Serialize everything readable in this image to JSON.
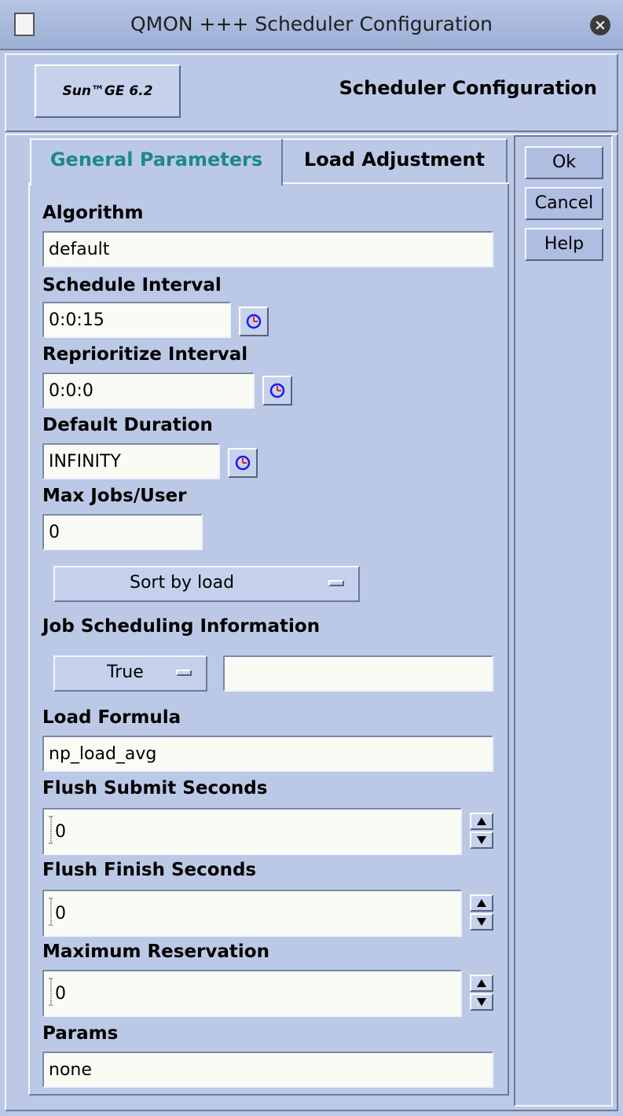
{
  "window": {
    "title": "QMON +++ Scheduler Configuration"
  },
  "header": {
    "logo_text": "Sun™GE 6.2",
    "title": "Scheduler Configuration"
  },
  "tabs": [
    {
      "label": "General Parameters",
      "selected": true
    },
    {
      "label": "Load Adjustment",
      "selected": false
    }
  ],
  "buttons": {
    "ok": "Ok",
    "cancel": "Cancel",
    "help": "Help"
  },
  "form": {
    "algorithm": {
      "label": "Algorithm",
      "value": "default"
    },
    "schedule_interval": {
      "label": "Schedule Interval",
      "value": "0:0:15"
    },
    "reprioritize_interval": {
      "label": "Reprioritize Interval",
      "value": "0:0:0"
    },
    "default_duration": {
      "label": "Default Duration",
      "value": "INFINITY"
    },
    "max_jobs_user": {
      "label": "Max Jobs/User",
      "value": "0"
    },
    "sort_menu": {
      "value": "Sort by load"
    },
    "job_scheduling_info": {
      "label": "Job Scheduling Information",
      "menu_value": "True",
      "text_value": ""
    },
    "load_formula": {
      "label": "Load Formula",
      "value": "np_load_avg"
    },
    "flush_submit_seconds": {
      "label": "Flush Submit Seconds",
      "value": "0"
    },
    "flush_finish_seconds": {
      "label": "Flush Finish Seconds",
      "value": "0"
    },
    "maximum_reservation": {
      "label": "Maximum Reservation",
      "value": "0"
    },
    "params": {
      "label": "Params",
      "value": "none"
    }
  },
  "colors": {
    "background": "#bcc9e6",
    "selected_tab_text": "#1d8a83",
    "field_background": "#fbfbf6",
    "clock_icon_ring": "#1a1aee",
    "clock_icon_hands": "#e02020"
  },
  "icons": {
    "clock": "clock-icon",
    "spin_up": "arrow-up-icon",
    "spin_down": "arrow-down-icon",
    "close": "close-icon",
    "window": "window-icon"
  }
}
